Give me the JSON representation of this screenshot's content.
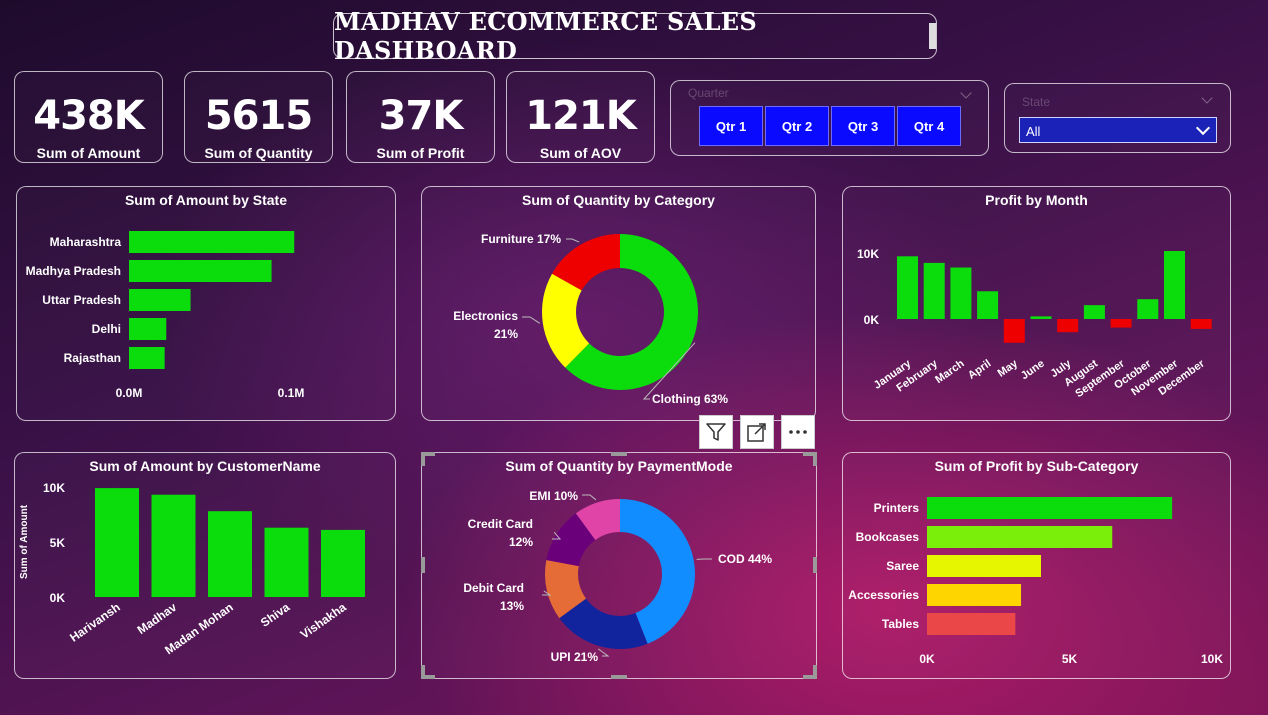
{
  "title": "MADHAV ECOMMERCE SALES DASHBOARD",
  "kpis": [
    {
      "value": "438K",
      "label": "Sum of Amount"
    },
    {
      "value": "5615",
      "label": "Sum of Quantity"
    },
    {
      "value": "37K",
      "label": "Sum of Profit"
    },
    {
      "value": "121K",
      "label": "Sum of AOV"
    }
  ],
  "quarter_slicer": {
    "header": "Quarter",
    "options": [
      "Qtr 1",
      "Qtr 2",
      "Qtr 3",
      "Qtr 4"
    ],
    "color": "#0a0aff"
  },
  "state_slicer": {
    "header": "State",
    "selected": "All"
  },
  "visual_toolbar": {
    "icons": [
      "filter-icon",
      "focus-mode-icon",
      "more-options-icon"
    ]
  },
  "chart_data": [
    {
      "id": "amount_by_state",
      "type": "bar",
      "orientation": "horizontal",
      "title": "Sum of Amount by State",
      "categories": [
        "Maharashtra",
        "Madhya Pradesh",
        "Uttar Pradesh",
        "Delhi",
        "Rajasthan"
      ],
      "values": [
        102000,
        88000,
        38000,
        23000,
        22000
      ],
      "tick_labels": [
        "0.0M",
        "0.1M"
      ],
      "xlim": [
        0,
        100000
      ],
      "color": "#0bdc0b"
    },
    {
      "id": "quantity_by_category",
      "type": "pie",
      "donut": true,
      "title": "Sum of Quantity by Category",
      "slices": [
        {
          "name": "Clothing",
          "label": "Clothing 63%",
          "value": 63,
          "color": "#0bdc0b"
        },
        {
          "name": "Electronics",
          "label": "Electronics 21%",
          "value": 21,
          "color": "#ffff00"
        },
        {
          "name": "Furniture",
          "label": "Furniture 17%",
          "value": 17,
          "color": "#ee0000"
        }
      ]
    },
    {
      "id": "profit_by_month",
      "type": "bar",
      "title": "Profit by Month",
      "categories": [
        "January",
        "February",
        "March",
        "April",
        "May",
        "June",
        "July",
        "August",
        "September",
        "October",
        "November",
        "December"
      ],
      "values": [
        9500,
        8500,
        7800,
        4200,
        -3600,
        400,
        -2000,
        2100,
        -1300,
        3000,
        10300,
        -1500
      ],
      "tick_labels": [
        "10K",
        "0K"
      ],
      "ylim": [
        -5000,
        12000
      ],
      "positive_color": "#0bdc0b",
      "negative_color": "#ee0000"
    },
    {
      "id": "amount_by_customer",
      "type": "bar",
      "title": "Sum of Amount by CustomerName",
      "ylabel": "Sum of Amount",
      "categories": [
        "Harivansh",
        "Madhav",
        "Madan Mohan",
        "Shiva",
        "Vishakha"
      ],
      "values": [
        9900,
        9300,
        7800,
        6300,
        6100
      ],
      "tick_labels": [
        "10K",
        "5K",
        "0K"
      ],
      "ylim": [
        0,
        10000
      ],
      "color": "#0bdc0b"
    },
    {
      "id": "quantity_by_payment",
      "type": "pie",
      "donut": true,
      "title": "Sum of Quantity by PaymentMode",
      "slices": [
        {
          "name": "COD",
          "label": "COD 44%",
          "value": 44,
          "color": "#118dff"
        },
        {
          "name": "UPI",
          "label": "UPI 21%",
          "value": 21,
          "color": "#12239e"
        },
        {
          "name": "Debit Card",
          "label": "Debit Card 13%",
          "value": 13,
          "color": "#e66c37"
        },
        {
          "name": "Credit Card",
          "label": "Credit Card 12%",
          "value": 12,
          "color": "#6b007b"
        },
        {
          "name": "EMI",
          "label": "EMI 10%",
          "value": 10,
          "color": "#e044a7"
        }
      ]
    },
    {
      "id": "profit_by_subcategory",
      "type": "bar",
      "orientation": "horizontal",
      "title": "Sum of Profit by Sub-Category",
      "categories": [
        "Printers",
        "Bookcases",
        "Saree",
        "Accessories",
        "Tables"
      ],
      "values": [
        8600,
        6500,
        4000,
        3300,
        3100
      ],
      "colors": [
        "#0bdc0b",
        "#7af00a",
        "#e6f500",
        "#ffd500",
        "#ea4848"
      ],
      "tick_labels": [
        "0K",
        "5K",
        "10K"
      ],
      "xlim": [
        0,
        10000
      ]
    }
  ]
}
